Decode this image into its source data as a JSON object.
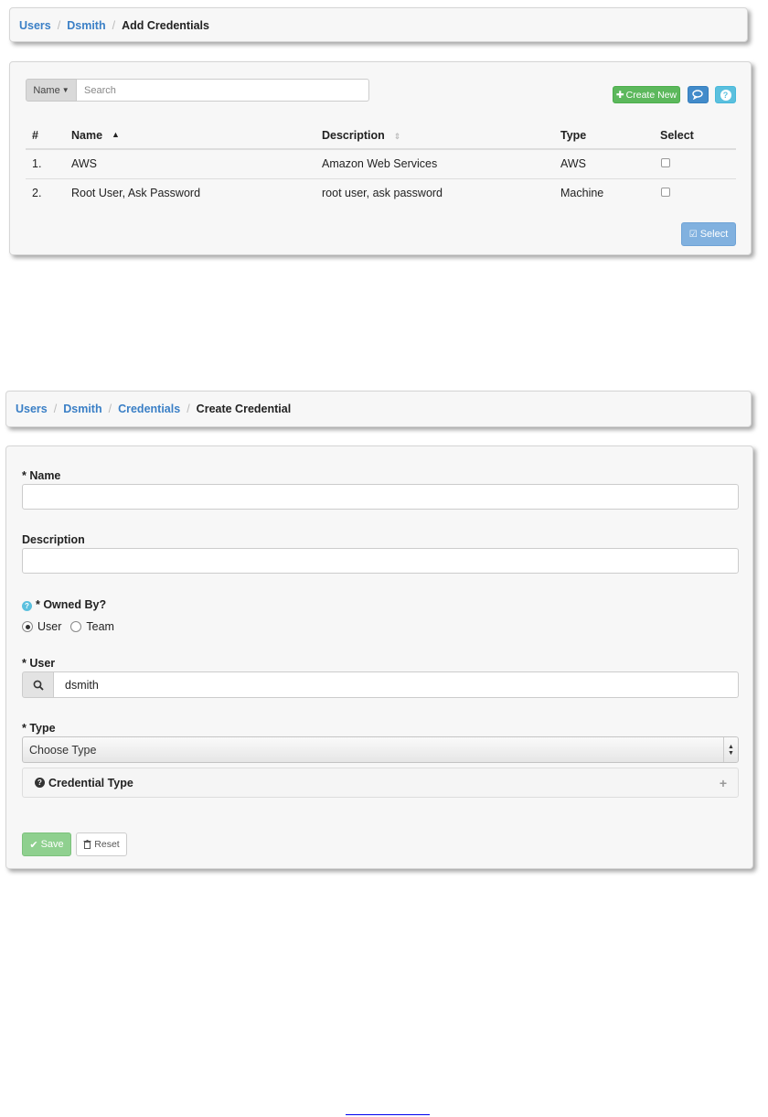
{
  "add_credentials": {
    "breadcrumb": [
      "Users",
      "Dsmith",
      "Add Credentials"
    ],
    "search": {
      "filter_label": "Name",
      "placeholder": "Search"
    },
    "buttons": {
      "create_new": "Create New",
      "select": "Select"
    },
    "icons": {
      "create": "plus-icon",
      "chat": "chat-icon",
      "help": "question-icon",
      "select": "check-square-icon"
    },
    "columns": [
      "#",
      "Name",
      "Description",
      "Type",
      "Select"
    ],
    "rows": [
      {
        "num": "1.",
        "name": "AWS",
        "description": "Amazon Web Services",
        "type": "AWS",
        "selected": false
      },
      {
        "num": "2.",
        "name": "Root User, Ask Password",
        "description": "root user, ask password",
        "type": "Machine",
        "selected": false
      }
    ]
  },
  "create_credential": {
    "breadcrumb": [
      "Users",
      "Dsmith",
      "Credentials",
      "Create Credential"
    ],
    "fields": {
      "name_label": "* Name",
      "name_value": "",
      "description_label": "Description",
      "description_value": "",
      "owned_by_label": "* Owned By?",
      "owner_options": [
        "User",
        "Team"
      ],
      "owner_selected": "User",
      "user_label": "* User",
      "user_value": "dsmith",
      "type_label": "* Type",
      "type_value": "Choose Type",
      "credential_type_label": "Credential Type"
    },
    "buttons": {
      "save": "Save",
      "reset": "Reset"
    }
  },
  "colors": {
    "link": "#3a7fc6",
    "success": "#5cb85c",
    "primary": "#428bca",
    "info": "#5bc0de"
  }
}
